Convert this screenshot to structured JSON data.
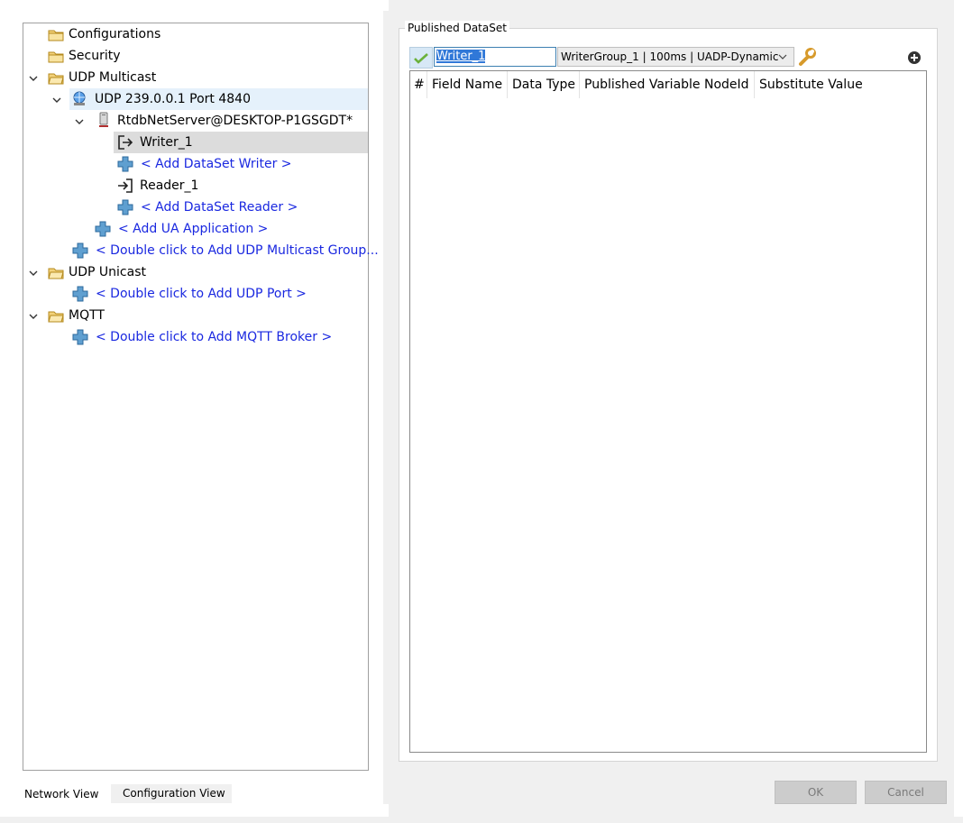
{
  "tree": {
    "configurations": "Configurations",
    "security": "Security",
    "udp_multicast": "UDP Multicast",
    "udp_address": "UDP 239.0.0.1 Port 4840",
    "server": "RtdbNetServer@DESKTOP-P1GSGDT*",
    "writer": "Writer_1",
    "add_writer": "< Add DataSet Writer >",
    "reader": "Reader_1",
    "add_reader": "< Add DataSet Reader >",
    "add_ua_app": "< Add UA Application >",
    "add_multicast_group": "< Double click to Add UDP Multicast Group...",
    "udp_unicast": "UDP Unicast",
    "add_udp_port": "< Double click to Add UDP Port >",
    "mqtt": "MQTT",
    "add_mqtt_broker": "< Double click to Add MQTT Broker >"
  },
  "tabs": {
    "network_view": "Network View",
    "configuration_view": "Configuration View"
  },
  "published": {
    "group_label": "Published DataSet",
    "writer_name": "Writer_1",
    "writer_group": "WriterGroup_1 | 100ms | UADP-Dynamic",
    "columns": [
      "#",
      "Field Name",
      "Data Type",
      "Published Variable NodeId",
      "Substitute Value"
    ]
  },
  "buttons": {
    "ok": "OK",
    "cancel": "Cancel"
  },
  "colors": {
    "link": "#1a28e0",
    "selection": "#dcdcdc",
    "hover": "#e5f1fb",
    "folder": "#e8c25a"
  }
}
